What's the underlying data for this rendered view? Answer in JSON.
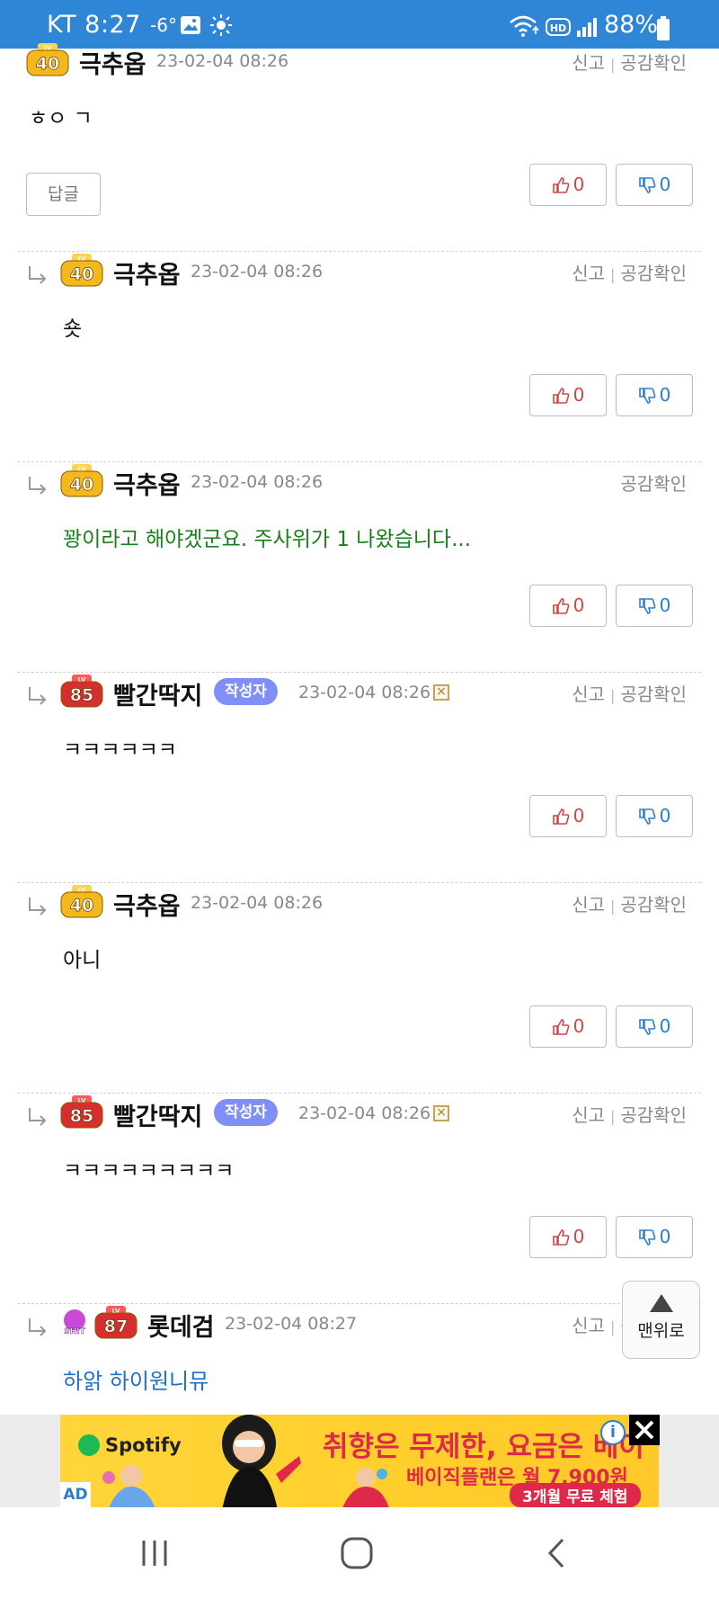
{
  "status_bar": {
    "carrier": "KT 8:27",
    "temperature": "-6°",
    "battery": "88%",
    "icons": [
      "image-icon",
      "sun-icon",
      "wifi-icon",
      "hd-icon",
      "signal-icon",
      "battery-icon"
    ]
  },
  "labels": {
    "report": "신고",
    "separator": "|",
    "empathy": "공감확인",
    "author": "작성자",
    "reply": "답글",
    "scroll_top": "맨위로",
    "ad": "AD"
  },
  "comments": [
    {
      "level": "40",
      "username": "극추옵",
      "date": "23-02-04 08:26",
      "text": "ㅎㅇ ㄱ",
      "up": "0",
      "down": "0",
      "has_report": true,
      "is_author": false,
      "is_reply": false,
      "text_color": "default"
    },
    {
      "level": "40",
      "username": "극추옵",
      "date": "23-02-04 08:26",
      "text": "숏",
      "up": "0",
      "down": "0",
      "has_report": true,
      "is_author": false,
      "is_reply": true,
      "text_color": "default"
    },
    {
      "level": "40",
      "username": "극추옵",
      "date": "23-02-04 08:26",
      "text": "꽝이라고 해야겠군요. 주사위가 1 나왔습니다...",
      "up": "0",
      "down": "0",
      "has_report": false,
      "is_author": false,
      "is_reply": true,
      "text_color": "#1a7f1a"
    },
    {
      "level": "85",
      "username": "빨간딱지",
      "date": "23-02-04 08:26",
      "text": "ㅋㅋㅋㅋㅋㅋ",
      "up": "0",
      "down": "0",
      "has_report": true,
      "is_author": true,
      "is_reply": true,
      "text_color": "default"
    },
    {
      "level": "40",
      "username": "극추옵",
      "date": "23-02-04 08:26",
      "text": "아니",
      "up": "0",
      "down": "0",
      "has_report": true,
      "is_author": false,
      "is_reply": true,
      "text_color": "default"
    },
    {
      "level": "85",
      "username": "빨간딱지",
      "date": "23-02-04 08:26",
      "text": "ㅋㅋㅋㅋㅋㅋㅋㅋㅋ",
      "up": "0",
      "down": "0",
      "has_report": true,
      "is_author": true,
      "is_reply": true,
      "text_color": "default"
    },
    {
      "level": "87",
      "extra_badge": "SHIT",
      "username": "롯데검",
      "date": "23-02-04 08:27",
      "text": "하앍 하이원니뮤",
      "has_report": true,
      "is_author": false,
      "is_reply": true,
      "text_color": "#1f6fc9"
    }
  ],
  "ad": {
    "brand": "Spotify",
    "headline": "취향은 무제한, 요금은 베이",
    "subline": "베이직플랜은 월 7,900원",
    "cta": "3개월 무료 체험"
  },
  "colors": {
    "status_bar": "#2f86d6",
    "thumb_up": "#d44545",
    "thumb_down": "#2b7fd1",
    "author_tag": "#7f8ff5",
    "ad_background": "#ffd53a"
  }
}
